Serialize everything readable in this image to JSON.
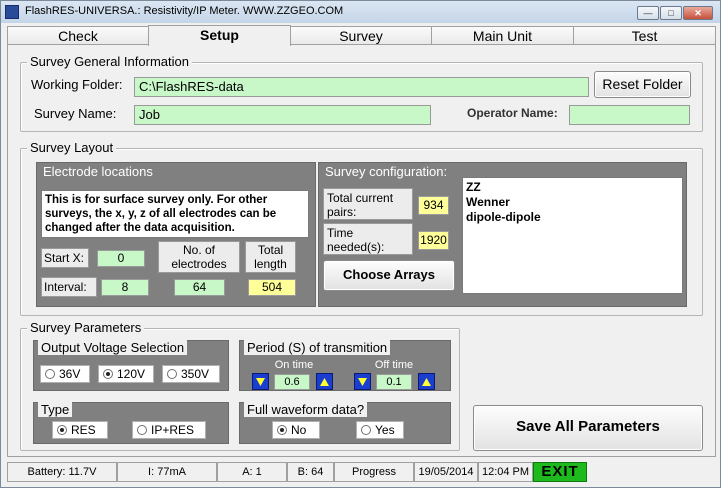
{
  "window": {
    "title": "FlashRES-UNIVERSA.: Resistivity/IP Meter.  WWW.ZZGEO.COM",
    "min_glyph": "—",
    "max_glyph": "□",
    "close_glyph": "✕"
  },
  "tabs": [
    {
      "label": "Check"
    },
    {
      "label": "Setup"
    },
    {
      "label": "Survey"
    },
    {
      "label": "Main Unit"
    },
    {
      "label": "Test"
    }
  ],
  "general": {
    "title": "Survey General Information",
    "working_folder_label": "Working Folder:",
    "working_folder_value": "C:\\FlashRES-data",
    "reset_folder_label": "Reset Folder",
    "survey_name_label": "Survey Name:",
    "survey_name_value": "Job",
    "operator_name_label": "Operator Name:",
    "operator_name_value": ""
  },
  "layout": {
    "title": "Survey Layout",
    "electrode": {
      "title": "Electrode locations",
      "note": "This is for surface survey only.  For other surveys, the x, y, z of all electrodes can be changed after the data acquisition.",
      "start_x_label": "Start X:",
      "start_x_value": "0",
      "num_electrodes_label": "No. of electrodes",
      "total_length_label": "Total length",
      "interval_label": "Interval:",
      "interval_value": "8",
      "num_electrodes_value": "64",
      "total_length_value": "504"
    },
    "config": {
      "title": "Survey configuration:",
      "total_pairs_label": "Total current pairs:",
      "total_pairs_value": "934",
      "time_needed_label": "Time needed(s):",
      "time_needed_value": "1920",
      "choose_arrays_label": "Choose Arrays",
      "arrays": [
        "ZZ",
        "Wenner",
        "dipole-dipole"
      ]
    }
  },
  "params": {
    "title": "Survey Parameters",
    "voltage": {
      "title": "Output Voltage Selection",
      "options": [
        {
          "label": "36V",
          "selected": false
        },
        {
          "label": "120V",
          "selected": true
        },
        {
          "label": "350V",
          "selected": false
        }
      ]
    },
    "period": {
      "title": "Period (S) of transmition",
      "on_time_label": "On time",
      "on_time_value": "0.6",
      "off_time_label": "Off time",
      "off_time_value": "0.1"
    },
    "type": {
      "title": "Type",
      "options": [
        {
          "label": "RES",
          "selected": true
        },
        {
          "label": "IP+RES",
          "selected": false
        }
      ]
    },
    "waveform": {
      "title": "Full waveform data?",
      "options": [
        {
          "label": "No",
          "selected": true
        },
        {
          "label": "Yes",
          "selected": false
        }
      ]
    }
  },
  "save_button_label": "Save All Parameters",
  "status": {
    "battery": "Battery: 11.7V",
    "current": "I: 77mA",
    "a": "A: 1",
    "b": "B: 64",
    "progress": "Progress",
    "date": "19/05/2014",
    "time": "12:04 PM",
    "exit_label": "EXIT"
  },
  "colors": {
    "input_green": "#c8f7c8",
    "highlight_yellow": "#ffff99",
    "arrow_blue": "#1a3fd0",
    "exit_green": "#1db91d",
    "header_gray": "#808080"
  }
}
